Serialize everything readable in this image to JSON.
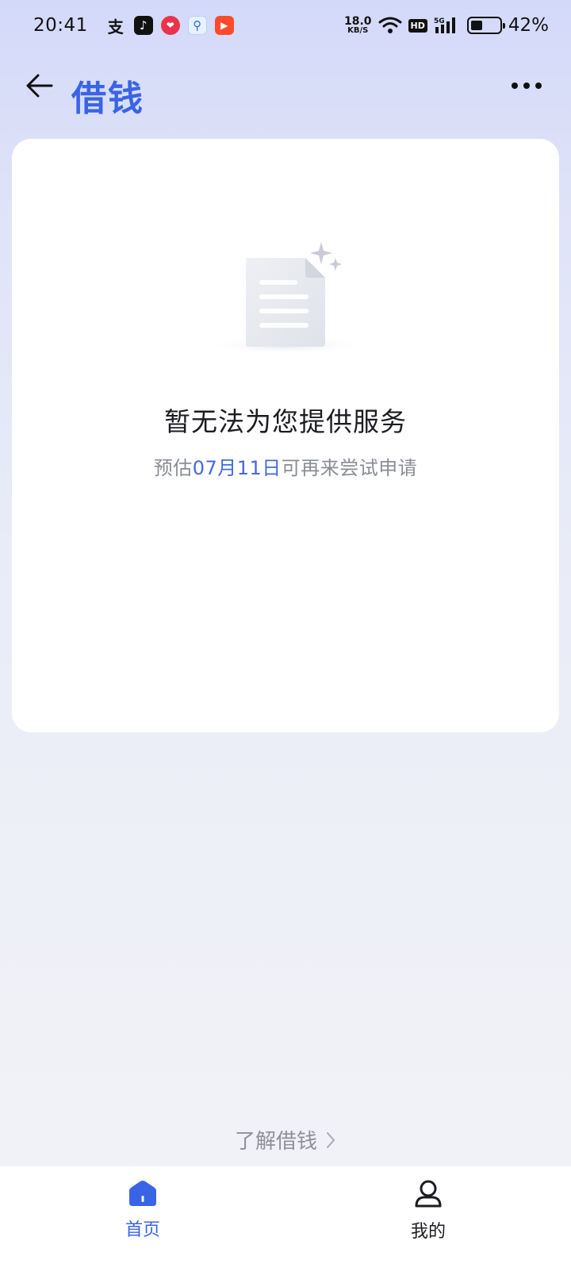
{
  "status_bar": {
    "time": "20:41",
    "net_speed_value": "18.0",
    "net_speed_unit": "KB/S",
    "hd_badge": "HD",
    "signal_label": "5G",
    "battery_percent": "42%",
    "battery_level": 0.42,
    "app_icons": [
      "alipay-icon",
      "tiktok-icon",
      "taobao-icon",
      "search-app-icon",
      "video-app-icon"
    ]
  },
  "header": {
    "title": "借钱",
    "back_icon": "arrow-left-icon",
    "more_icon": "more-dots-icon"
  },
  "card": {
    "title": "暂无法为您提供服务",
    "subtitle_prefix": "预估",
    "subtitle_date": "07月11日",
    "subtitle_suffix": "可再来尝试申请",
    "illustration": "empty-document-icon"
  },
  "learn_link": {
    "label": "了解借钱",
    "icon": "chevron-right-icon"
  },
  "bottom_nav": {
    "items": [
      {
        "label": "首页",
        "icon": "home-icon",
        "active": true
      },
      {
        "label": "我的",
        "icon": "user-icon",
        "active": false
      }
    ]
  },
  "colors": {
    "accent": "#3a64e6",
    "date_highlight": "#4469e0",
    "title_text": "#1c1d22",
    "secondary_text": "#8a8d96"
  }
}
